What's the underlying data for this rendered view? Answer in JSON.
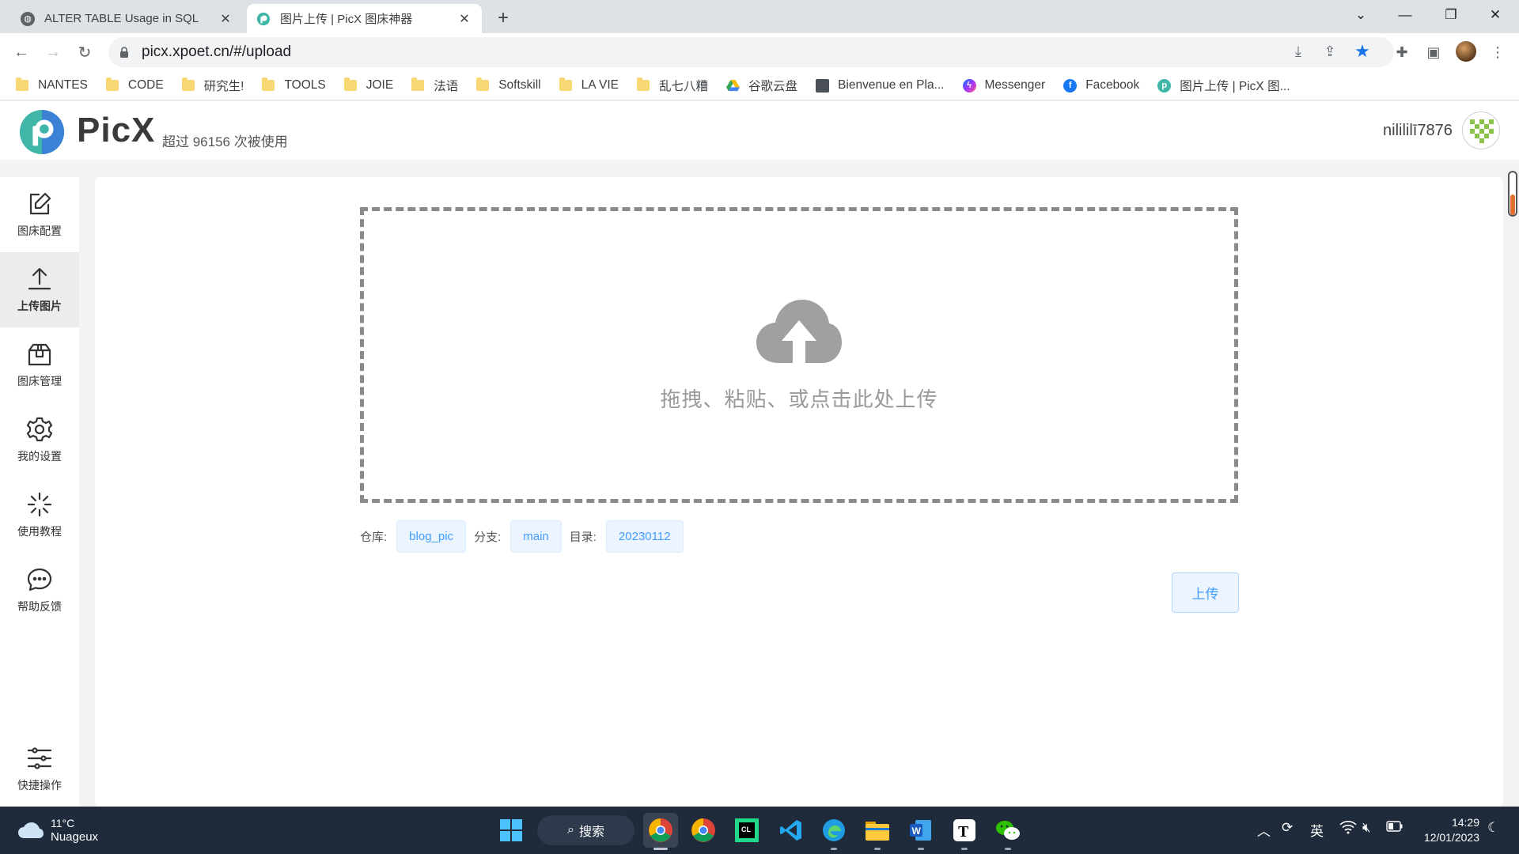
{
  "browser": {
    "tabs": [
      {
        "title": "ALTER TABLE Usage in SQL",
        "close": "✕"
      },
      {
        "title": "图片上传 | PicX 图床神器",
        "close": "✕"
      }
    ],
    "new_tab": "+",
    "window_controls": {
      "tab_search": "⌄",
      "minimize": "—",
      "restore": "❐",
      "close": "✕"
    },
    "url": "picx.xpoet.cn/#/upload",
    "bookmarks": [
      {
        "label": "NANTES",
        "icon": "folder-icon"
      },
      {
        "label": "CODE",
        "icon": "folder-icon"
      },
      {
        "label": "研究生!",
        "icon": "folder-icon"
      },
      {
        "label": "TOOLS",
        "icon": "folder-icon"
      },
      {
        "label": "JOIE",
        "icon": "folder-icon"
      },
      {
        "label": "法语",
        "icon": "folder-icon"
      },
      {
        "label": "Softskill",
        "icon": "folder-icon"
      },
      {
        "label": "LA VIE",
        "icon": "folder-icon"
      },
      {
        "label": "乱七八糟",
        "icon": "folder-icon"
      },
      {
        "label": "谷歌云盘",
        "icon": "google-drive-icon"
      },
      {
        "label": "Bienvenue en Pla...",
        "icon": "site-icon"
      },
      {
        "label": "Messenger",
        "icon": "messenger-icon"
      },
      {
        "label": "Facebook",
        "icon": "facebook-icon"
      },
      {
        "label": "图片上传 | PicX 图...",
        "icon": "picx-icon"
      }
    ]
  },
  "app": {
    "brand": "PicX",
    "usage_text": "超过 96156 次被使用",
    "username": "nilililī7876",
    "sidebar": [
      {
        "label": "图床配置",
        "icon": "edit-icon",
        "active": false
      },
      {
        "label": "上传图片",
        "icon": "upload-icon",
        "active": true
      },
      {
        "label": "图床管理",
        "icon": "box-icon",
        "active": false
      },
      {
        "label": "我的设置",
        "icon": "gear-icon",
        "active": false
      },
      {
        "label": "使用教程",
        "icon": "loader-icon",
        "active": false
      },
      {
        "label": "帮助反馈",
        "icon": "chat-icon",
        "active": false
      }
    ],
    "sidebar_bottom": {
      "label": "快捷操作",
      "icon": "sliders-icon"
    },
    "dropzone_hint": "拖拽、粘贴、或点击此处上传",
    "repo_label": "仓库:",
    "repo_value": "blog_pic",
    "branch_label": "分支:",
    "branch_value": "main",
    "dir_label": "目录:",
    "dir_value": "20230112",
    "upload_button": "上传"
  },
  "taskbar": {
    "temperature": "11°C",
    "condition": "Nuageux",
    "search": "搜索",
    "ime": "英",
    "time": "14:29",
    "date": "12/01/2023"
  },
  "colors": {
    "accent": "#409eff",
    "chip_bg": "#ecf5ff",
    "logo_teal": "#3fb6a8",
    "logo_blue": "#3b82d6",
    "taskbar": "#1f2a3a"
  }
}
